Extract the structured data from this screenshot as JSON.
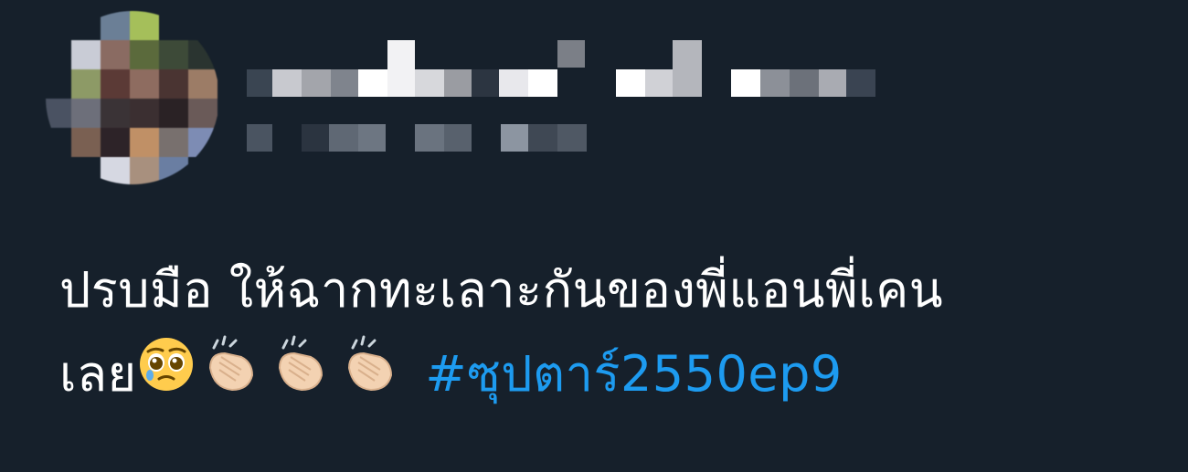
{
  "tweet": {
    "line1": "ปรบมือ ให้ฉากทะเลาะกันของพี่แอนพี่เคน",
    "line2": "เลย",
    "hashtag": "#ซุปตาร์2550ep9"
  },
  "emoji": {
    "pleading": "pleading-face-emoji",
    "clap": "clapping-hands-emoji"
  },
  "colors": {
    "background": "#16202b",
    "text": "#ffffff",
    "link": "#1d9bf0"
  }
}
